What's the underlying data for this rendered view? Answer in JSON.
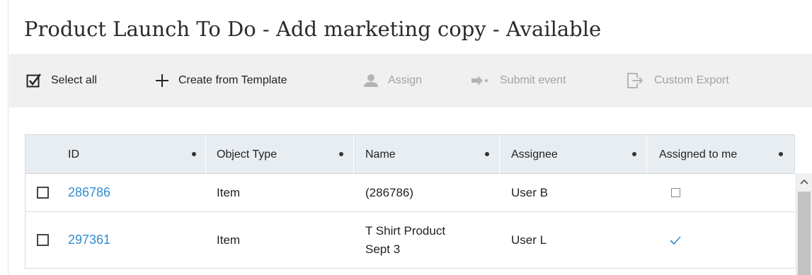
{
  "page": {
    "title": "Product Launch To Do - Add marketing copy - Available"
  },
  "toolbar": {
    "select_all": {
      "label": "Select all",
      "icon": "checkbox-select-all-icon"
    },
    "create_from_template": {
      "label": "Create from Template",
      "icon": "plus-icon"
    },
    "assign": {
      "label": "Assign",
      "icon": "user-icon",
      "disabled": true
    },
    "submit_event": {
      "label": "Submit event",
      "icon": "arrow-right-icon",
      "disabled": true
    },
    "custom_export": {
      "label": "Custom Export",
      "icon": "export-icon",
      "disabled": true
    }
  },
  "table": {
    "columns": [
      "ID",
      "Object Type",
      "Name",
      "Assignee",
      "Assigned to me"
    ],
    "rows": [
      {
        "id": "286786",
        "object_type": "Item",
        "name": "(286786)",
        "assignee": "User B",
        "assigned_to_me": false
      },
      {
        "id": "297361",
        "object_type": "Item",
        "name_line1": "T Shirt Product",
        "name_line2": "Sept 3",
        "assignee": "User L",
        "assigned_to_me": true
      }
    ]
  },
  "colors": {
    "link": "#2e8dd1",
    "toolbar_bg": "#f0f0f0",
    "header_bg": "#e8edf1",
    "disabled_text": "#a2a2a2"
  }
}
